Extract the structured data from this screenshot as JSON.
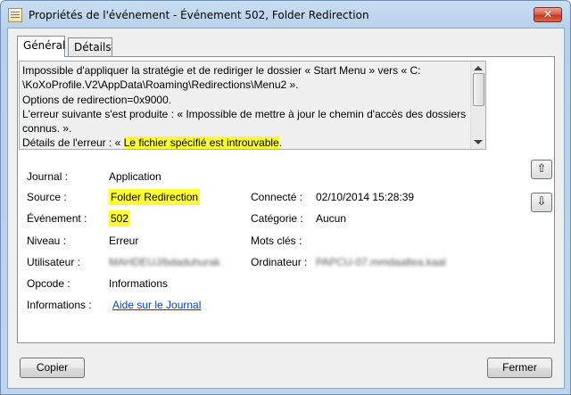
{
  "window": {
    "title": "Propriétés de l'événement - Événement 502, Folder Redirection",
    "close_glyph": "✕"
  },
  "tabs": [
    {
      "label": "Général",
      "active": true
    },
    {
      "label": "Détails",
      "active": false
    }
  ],
  "message": {
    "line1": "Impossible d'appliquer la stratégie et de rediriger le dossier « Start Menu » vers « C:",
    "line2": "\\KoXoProfile.V2\\AppData\\Roaming\\Redirections\\Menu2 ».",
    "line3": " Options de redirection=0x9000.",
    "line4": " L'erreur suivante s'est produite : « Impossible de mettre à jour le chemin d'accès des dossiers",
    "line5": "connus. ».",
    "line6_prefix": " Détails de l'erreur : « ",
    "line6_highlight": "Le fichier spécifié est introuvable",
    "line6_suffix": "."
  },
  "details": {
    "journal_label": "Journal :",
    "journal_value": "Application",
    "source_label": "Source :",
    "source_value": "Folder Redirection",
    "connected_label": "Connecté :",
    "connected_value": "02/10/2014 15:28:39",
    "event_label": "Événement :",
    "event_value": "502",
    "category_label": "Catégorie :",
    "category_value": "Aucun",
    "level_label": "Niveau :",
    "level_value": "Erreur",
    "keywords_label": "Mots clés :",
    "keywords_value": "",
    "user_label": "Utilisateur :",
    "user_value": "MAHDEUJ/bdaduhurak",
    "computer_label": "Ordinateur :",
    "computer_value": "PAPCU-07.mmdaaltea.kaal",
    "opcode_label": "Opcode :",
    "opcode_value": "Informations",
    "info_label": "Informations :",
    "info_link": "Aide sur le Journal"
  },
  "buttons": {
    "copy": "Copier",
    "close": "Fermer",
    "prev_glyph": "⇧",
    "next_glyph": "⇩"
  },
  "colors": {
    "highlight": "#ffff33",
    "link": "#0645ad",
    "title_bar": "#bed4ec",
    "close_button": "#c23a22"
  }
}
